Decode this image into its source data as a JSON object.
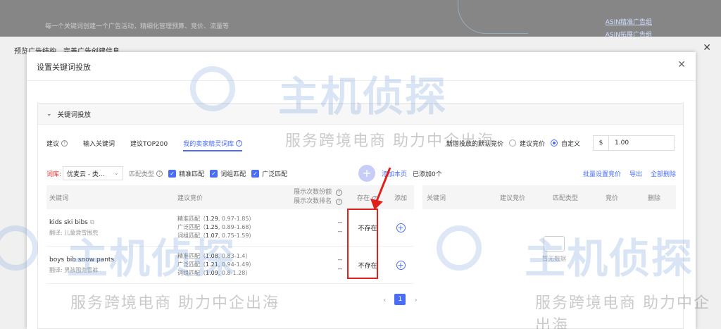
{
  "background": {
    "top_text": "每一个关键词创建一个广告活动，精细化管理预算、竞价、流量等",
    "asin_link_1": "ASIN精准广告组",
    "asin_link_2": "ASIN拓展广告组"
  },
  "outer_dialog": {
    "title": "预览广告结构、完善广告创建信息"
  },
  "inner_dialog": {
    "title": "设置关键词投放"
  },
  "panel": {
    "header": "关键词投放"
  },
  "tabs": [
    {
      "label": "建议",
      "active": false
    },
    {
      "label": "输入关键词",
      "active": false
    },
    {
      "label": "建议TOP200",
      "active": false
    },
    {
      "label": "我的卖家精灵词库",
      "active": true
    }
  ],
  "default_bid": {
    "label": "新增投放的默认竞价",
    "option_suggest": "建议竞价",
    "option_custom": "自定义",
    "currency": "$",
    "value": "1.00"
  },
  "filter": {
    "library_label": "词库:",
    "library_value": "优麦云 - 类...",
    "match_type_label": "匹配类型",
    "exact": "精准匹配",
    "phrase": "词组匹配",
    "broad": "广泛匹配",
    "add_page": "添加本页",
    "added_count": "已添加0个",
    "batch_bid": "批量设置竞价",
    "export": "导出",
    "delete_all": "全部删除"
  },
  "left_table": {
    "headers": {
      "keyword": "关键词",
      "suggested_bid": "建议竞价",
      "impression_share": "展示次数份额",
      "impression_rank": "展示次数排名",
      "exists": "存在",
      "add": "添加"
    },
    "rows": [
      {
        "keyword": "kids ski bibs",
        "translation": "翻译: 儿童滑雪围兜",
        "bids": [
          {
            "type": "精准匹配",
            "value": "1.29",
            "range": "0.97-1.85"
          },
          {
            "type": "广泛匹配",
            "value": "1.25",
            "range": "0.89-1.68"
          },
          {
            "type": "词组匹配",
            "value": "1.07",
            "range": "0.75-1.59"
          }
        ],
        "share": "--",
        "rank": "--",
        "exists": "不存在"
      },
      {
        "keyword": "boys bib snow pants",
        "translation": "翻译: 男孩围兜雪裤",
        "bids": [
          {
            "type": "精准匹配",
            "value": "1.08",
            "range": "0.83-1.4"
          },
          {
            "type": "广泛匹配",
            "value": "1.21",
            "range": "0.94-1.49"
          },
          {
            "type": "词组匹配",
            "value": "1.09",
            "range": "0.8-1.28"
          }
        ],
        "share": "--",
        "rank": "--",
        "exists": "不存在"
      }
    ]
  },
  "right_table": {
    "headers": [
      "关键词",
      "建议竞价",
      "匹配类型",
      "竞价",
      "删除"
    ],
    "empty_text": "暂无数据"
  },
  "pagination": {
    "current": "1"
  },
  "watermark": {
    "logo": "主机侦探",
    "slogan": "服务跨境电商  助力中企出海"
  }
}
